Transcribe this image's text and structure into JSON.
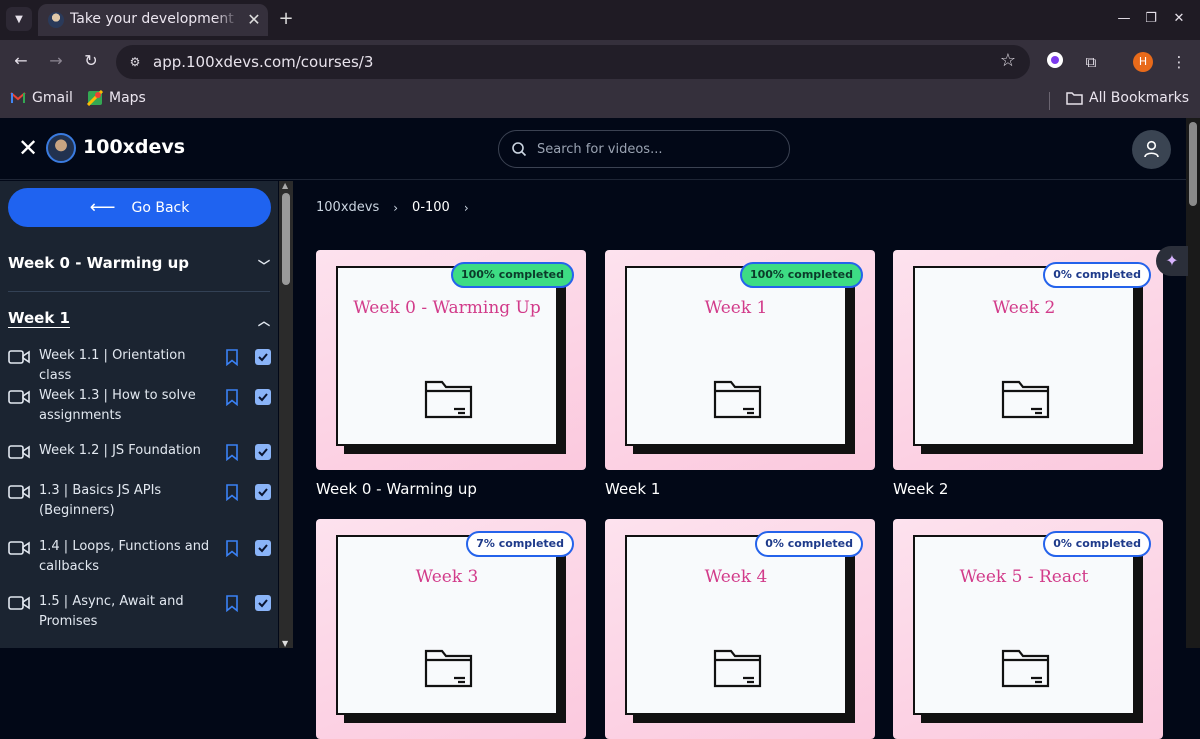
{
  "browser": {
    "tab_title": "Take your development s",
    "url": "app.100xdevs.com/courses/3",
    "profile_initial": "H",
    "bookmarks": [
      {
        "label": "Gmail",
        "icon": "gmail-icon"
      },
      {
        "label": "Maps",
        "icon": "maps-icon"
      }
    ],
    "all_bookmarks_label": "All Bookmarks"
  },
  "app": {
    "brand": "100xdevs",
    "search_placeholder": "Search for videos...",
    "go_back_label": "Go Back",
    "accent_color": "#1f63f0"
  },
  "sidebar": {
    "weeks": [
      {
        "label": "Week 0 - Warming up",
        "expanded": false
      },
      {
        "label": "Week 1",
        "expanded": true
      }
    ],
    "lessons": [
      {
        "title": "Week 1.1 | Orientation class",
        "completed": true
      },
      {
        "title": "Week 1.3 | How to solve assignments",
        "completed": true
      },
      {
        "title": "Week 1.2 | JS Foundation",
        "completed": true
      },
      {
        "title": "1.3 | Basics JS APIs (Beginners)",
        "completed": true
      },
      {
        "title": "1.4 | Loops, Functions and callbacks",
        "completed": true
      },
      {
        "title": "1.5 | Async, Await and Promises",
        "completed": true
      }
    ]
  },
  "breadcrumb": [
    "100xdevs",
    "0-100"
  ],
  "cards": [
    {
      "title": "Week 0 - Warming Up",
      "caption": "Week 0 - Warming up",
      "badge": "100% completed",
      "progress": 100
    },
    {
      "title": "Week 1",
      "caption": "Week 1",
      "badge": "100% completed",
      "progress": 100
    },
    {
      "title": "Week 2",
      "caption": "Week 2",
      "badge": "0% completed",
      "progress": 0
    },
    {
      "title": "Week 3",
      "caption": "",
      "badge": "7% completed",
      "progress": 7
    },
    {
      "title": "Week 4",
      "caption": "",
      "badge": "0% completed",
      "progress": 0
    },
    {
      "title": "Week 5 - React",
      "caption": "",
      "badge": "0% completed",
      "progress": 0
    }
  ]
}
